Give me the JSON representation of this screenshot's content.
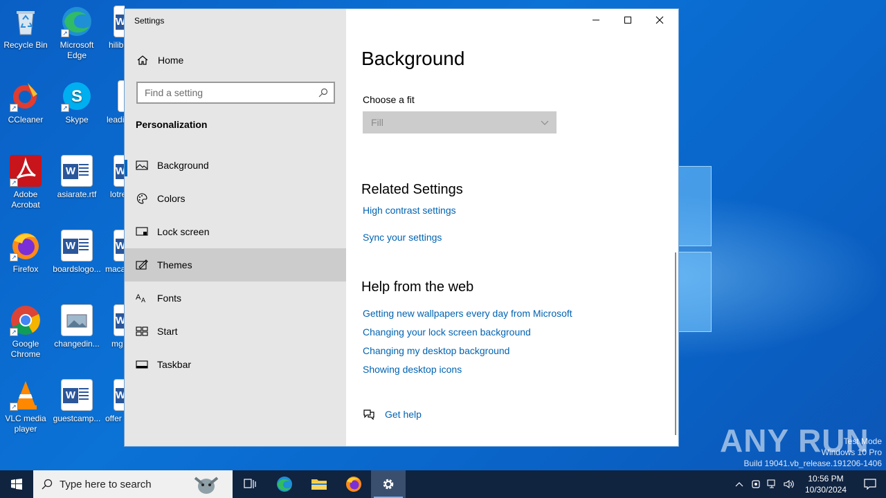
{
  "desktop": {
    "icons": [
      {
        "label": "Recycle Bin"
      },
      {
        "label": "Microsoft Edge"
      },
      {
        "label": "hilib"
      },
      {
        "label": "CCleaner"
      },
      {
        "label": "Skype"
      },
      {
        "label": "leadi"
      },
      {
        "label": "Adobe Acrobat"
      },
      {
        "label": "asiarate.rtf"
      },
      {
        "label": "lotre"
      },
      {
        "label": "Firefox"
      },
      {
        "label": "boardslogo..."
      },
      {
        "label": "maca"
      },
      {
        "label": "Google Chrome"
      },
      {
        "label": "changedin..."
      },
      {
        "label": "mg"
      },
      {
        "label": "VLC media player"
      },
      {
        "label": "guestcamp..."
      },
      {
        "label": "offer"
      }
    ]
  },
  "window": {
    "title": "Settings",
    "controls": {
      "minimize": "minimize",
      "maximize": "maximize",
      "close": "close"
    }
  },
  "nav": {
    "home_label": "Home",
    "search_placeholder": "Find a setting",
    "section_title": "Personalization",
    "items": [
      {
        "label": "Background",
        "icon": "picture-icon"
      },
      {
        "label": "Colors",
        "icon": "palette-icon"
      },
      {
        "label": "Lock screen",
        "icon": "lock-screen-icon"
      },
      {
        "label": "Themes",
        "icon": "themes-icon",
        "selected": true
      },
      {
        "label": "Fonts",
        "icon": "fonts-icon"
      },
      {
        "label": "Start",
        "icon": "start-icon"
      },
      {
        "label": "Taskbar",
        "icon": "taskbar-icon"
      }
    ]
  },
  "content": {
    "title": "Background",
    "fit_label": "Choose a fit",
    "fit_value": "Fill",
    "related_heading": "Related Settings",
    "related_links": [
      "High contrast settings",
      "Sync your settings"
    ],
    "help_heading": "Help from the web",
    "help_links": [
      "Getting new wallpapers every day from Microsoft",
      "Changing your lock screen background",
      "Changing my desktop background",
      "Showing desktop icons"
    ],
    "get_help": "Get help"
  },
  "watermark": {
    "line1": "Test Mode",
    "line2": "Windows 10 Pro",
    "line3": "Build 19041.vb_release.191206-1406",
    "brand": "ANY RUN"
  },
  "taskbar": {
    "search_placeholder": "Type here to search",
    "time": "10:56 PM",
    "date": "10/30/2024"
  },
  "colors": {
    "accent": "#0067c0",
    "link": "#0063b1",
    "taskbar": "#10233f"
  }
}
